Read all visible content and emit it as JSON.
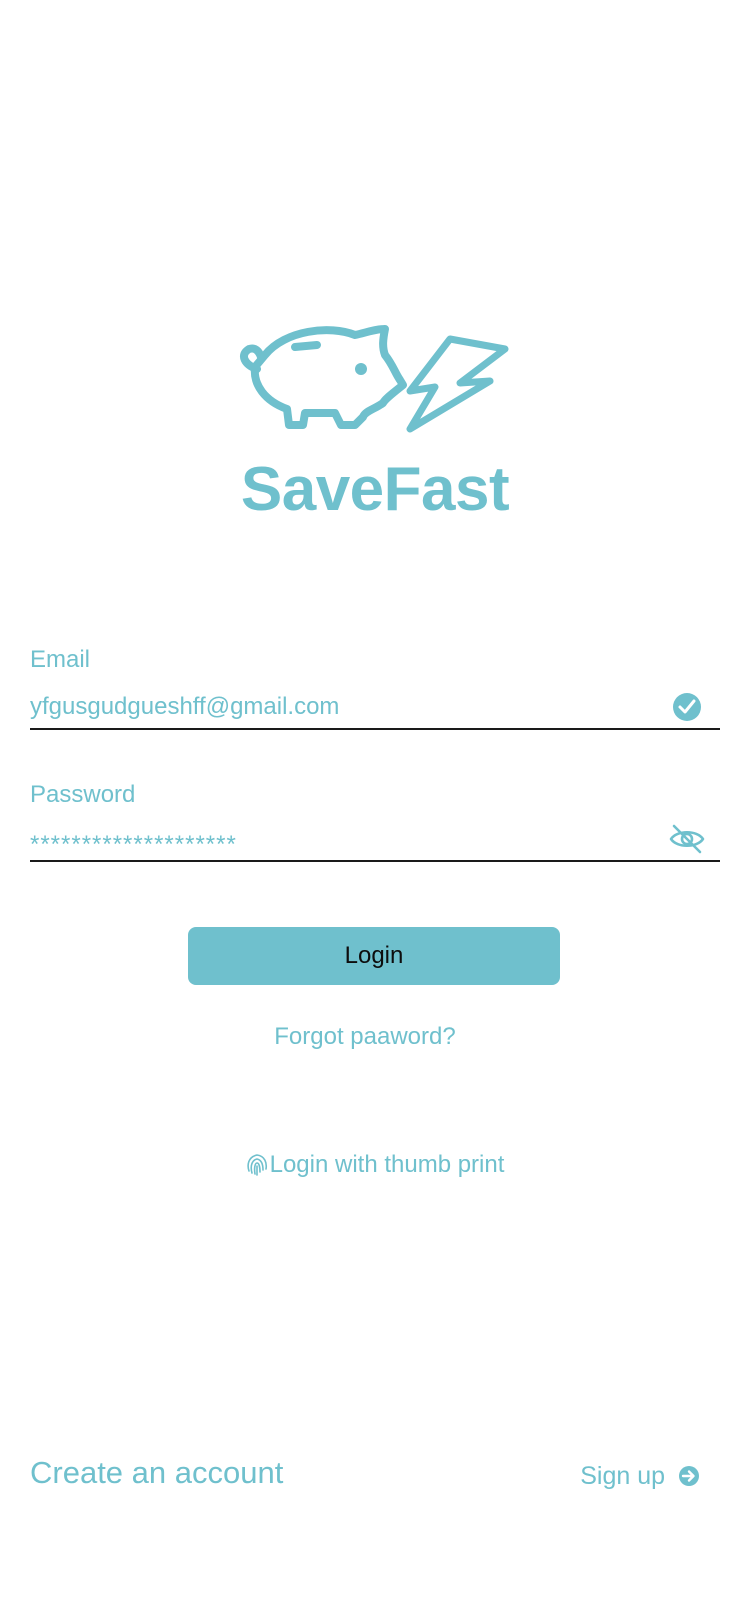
{
  "brand": {
    "name": "SaveFast",
    "logo_icon": "piggy-bank-lightning-icon",
    "accent_color": "#6fc0cd"
  },
  "email": {
    "label": "Email",
    "value": "yfgusgudgueshff@gmail.com",
    "status_icon": "check-circle-icon"
  },
  "password": {
    "label": "Password",
    "value": "********************",
    "toggle_icon": "eye-slash-icon"
  },
  "actions": {
    "login_label": "Login",
    "forgot_label": "Forgot paaword?",
    "thumb_label": "Login with thumb print",
    "thumb_icon": "fingerprint-icon"
  },
  "footer": {
    "create_label": "Create an account",
    "signup_label": "Sign up",
    "signup_icon": "arrow-right-circle-icon"
  }
}
